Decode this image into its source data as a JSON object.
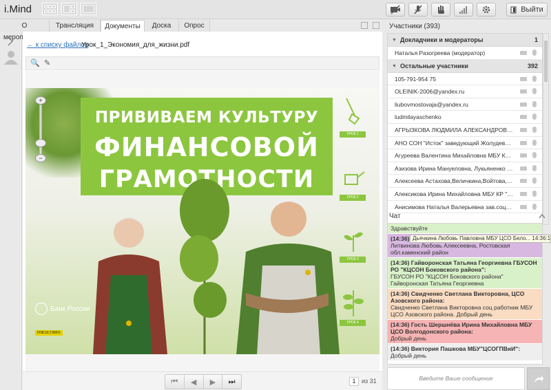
{
  "app": {
    "logo": "i.Mind",
    "exit_label": "Выйти",
    "controls": [
      "camera-off-icon",
      "mic-off-icon",
      "hand-icon",
      "signal-icon",
      "gear-icon"
    ]
  },
  "tabs": [
    {
      "label": "О мероприятии",
      "active": false
    },
    {
      "label": "Трансляция",
      "active": false
    },
    {
      "label": "Документы",
      "active": true
    },
    {
      "label": "Доска",
      "active": false
    },
    {
      "label": "Опрос",
      "active": false
    }
  ],
  "doc": {
    "back_link": "← к списку файлов",
    "filename": "Урок_1_Экономия_для_жизни.pdf",
    "slide": {
      "title_line1": "ПРИВИВАЕМ КУЛЬТУРУ",
      "title_line2": "ФИНАНСОВОЙ",
      "title_line3": "ГРАМОТНОСТИ",
      "bank": "Банк России",
      "fincult": "FINCULT.INFO",
      "stages": [
        "УРОК 1",
        "УРОК 2",
        "УРОК 3",
        "УРОК 4"
      ]
    },
    "page_current": "1",
    "page_total": "из 31"
  },
  "participants": {
    "header": "Участники (393)",
    "group1": {
      "title": "Докладчики и модераторы",
      "count": "1"
    },
    "group1_items": [
      "Наталья Разогреева (модератор)"
    ],
    "group2": {
      "title": "Остальные участники",
      "count": "392"
    },
    "group2_items": [
      "105-791-954 75",
      "OLEINIK-2006@yandex.ru",
      "liubovmostovaja@yandex.ru",
      "ludmilayaschenko",
      "АГРЫЗКОВА ЛЮДМИЛА АЛЕКСАНДРОВНА",
      "АНО СОН \"Исток\" заведующий Жолудева А.В.",
      "Агуреева Валентина Михайловна МБУ КР Ц...",
      "Азизова Ирина Мануеловна, Лукьяненко Ли...",
      "Алексеева Астахова,Величкина,Войтова,В...",
      "Алексикова Ирина Михайловна МБУ КР \"ЦС...",
      "Анисимова Наталья Валерьевна зав.соц.отд..."
    ]
  },
  "chat": {
    "header": "Чат",
    "input_placeholder": "Введите Ваше сообщение",
    "tooltip": "Дьячкина Любовь Павловна МБУ ЦСО Бело... 14:36:17",
    "messages": [
      {
        "color": "green",
        "author": "",
        "body": "Здравствуйте"
      },
      {
        "color": "purple",
        "author": "(14:36)",
        "body": "Литвинова Любовь Алексеевна, Ростовская обл.каменский район"
      },
      {
        "color": "green",
        "author": "(14:36) Гайворонская Татьяна Георгиевна ГБУСОН РО \"КЦСОН Боковского района\":",
        "body": "ГБУСОН РО \"КЦСОН Боковского района\" Гайворонская Татьяна Георгиевна"
      },
      {
        "color": "orange",
        "author": "(14:36) Свидченко Светлана Викторовна, ЦСО Азовского района:",
        "body": "Свидченко Светлана Викторовна соц работник МБУ ЦСО Азовского района. Добрый день"
      },
      {
        "color": "red",
        "author": "(14:36) Гость Шершнёва Ирина Михайловна МБУ ЦСО Волгодонского района:",
        "body": "Добрый день"
      },
      {
        "color": "gray",
        "author": "(14:36) Виктория Пашкова МБУ\"ЦСОГПВиИ\":",
        "body": "Добрый день"
      }
    ]
  }
}
